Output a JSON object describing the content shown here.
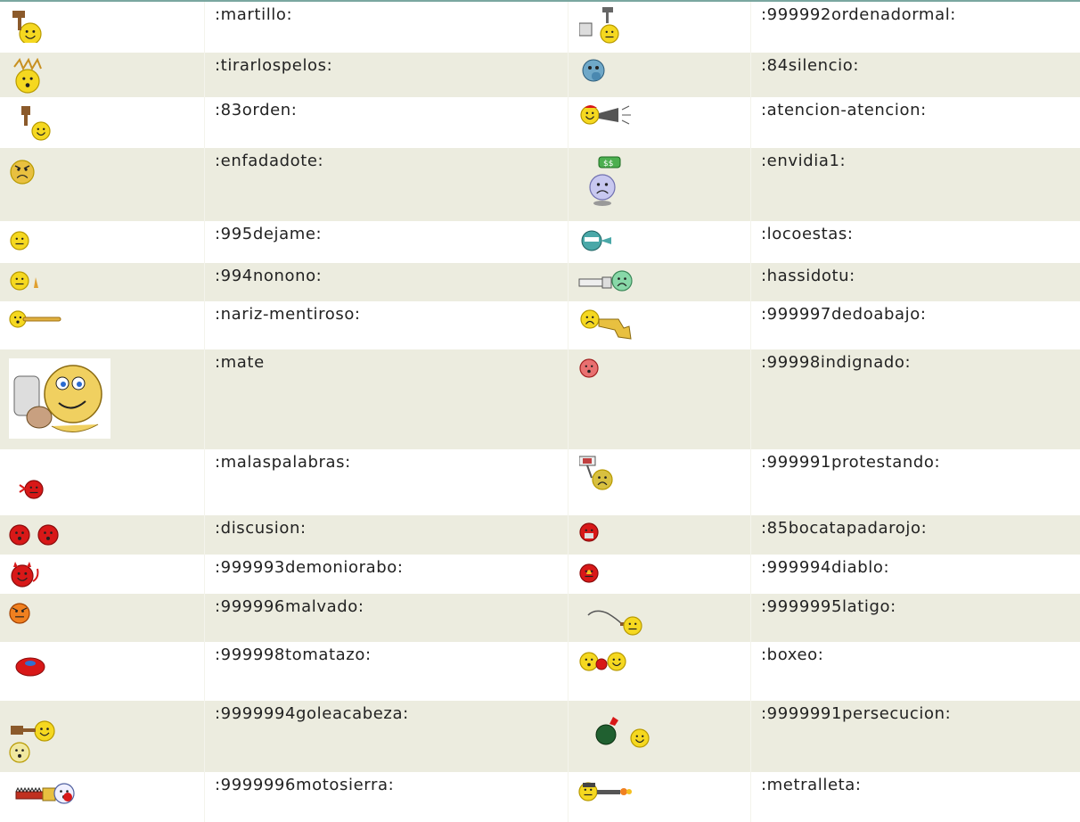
{
  "rows": [
    {
      "left": {
        "code": ":martillo:",
        "icon": "hammer-smiley-icon"
      },
      "right": {
        "code": ":999992ordenadormal:",
        "icon": "smashed-computer-smiley-icon"
      }
    },
    {
      "left": {
        "code": ":tirarlospelos:",
        "icon": "pulling-hair-smiley-icon"
      },
      "right": {
        "code": ":84silencio:",
        "icon": "silence-smiley-icon"
      }
    },
    {
      "left": {
        "code": ":83orden:",
        "icon": "gavel-order-smiley-icon"
      },
      "right": {
        "code": ":atencion-atencion:",
        "icon": "megaphone-smiley-icon"
      }
    },
    {
      "left": {
        "code": ":enfadadote:",
        "icon": "angry-smiley-icon"
      },
      "right": {
        "code": ":envidia1:",
        "icon": "envy-smiley-icon"
      }
    },
    {
      "left": {
        "code": ":995dejame:",
        "icon": "leave-me-smiley-icon"
      },
      "right": {
        "code": ":locoestas:",
        "icon": "crazy-smiley-icon"
      }
    },
    {
      "left": {
        "code": ":994nonono:",
        "icon": "no-no-finger-smiley-icon"
      },
      "right": {
        "code": ":hassidotu:",
        "icon": "pointing-finger-smiley-icon"
      }
    },
    {
      "left": {
        "code": ":nariz-mentiroso:",
        "icon": "liar-nose-smiley-icon"
      },
      "right": {
        "code": ":999997dedoabajo:",
        "icon": "thumbs-down-smiley-icon"
      }
    },
    {
      "left": {
        "code": ":mate",
        "icon": "mate-smiley-icon"
      },
      "right": {
        "code": ":99998indignado:",
        "icon": "indignant-smiley-icon"
      }
    },
    {
      "left": {
        "code": ":malaspalabras:",
        "icon": "bad-words-smiley-icon"
      },
      "right": {
        "code": ":999991protestando:",
        "icon": "protest-sign-smiley-icon"
      }
    },
    {
      "left": {
        "code": ":discusion:",
        "icon": "argument-smileys-icon"
      },
      "right": {
        "code": ":85bocatapadarojo:",
        "icon": "covered-mouth-red-smiley-icon"
      }
    },
    {
      "left": {
        "code": ":999993demoniorabo:",
        "icon": "devil-tail-smiley-icon"
      },
      "right": {
        "code": ":999994diablo:",
        "icon": "devil-fire-smiley-icon"
      }
    },
    {
      "left": {
        "code": ":999996malvado:",
        "icon": "evil-smiley-icon"
      },
      "right": {
        "code": ":9999995latigo:",
        "icon": "whip-smiley-icon"
      }
    },
    {
      "left": {
        "code": ":999998tomatazo:",
        "icon": "tomato-splat-icon"
      },
      "right": {
        "code": ":boxeo:",
        "icon": "boxing-smileys-icon"
      }
    },
    {
      "left": {
        "code": ":9999994goleacabeza:",
        "icon": "hit-head-smiley-icon"
      },
      "right": {
        "code": ":9999991persecucion:",
        "icon": "bomb-chase-smiley-icon"
      }
    },
    {
      "left": {
        "code": ":9999996motosierra:",
        "icon": "chainsaw-smiley-icon"
      },
      "right": {
        "code": ":metralleta:",
        "icon": "machine-gun-smiley-icon"
      }
    }
  ],
  "colors": {
    "row_shade": "#ececdf",
    "row_plain": "#ffffff",
    "text": "#222222",
    "smiley_yellow": "#f5d820",
    "smiley_red": "#d81818",
    "top_border": "#7aa7a0"
  }
}
